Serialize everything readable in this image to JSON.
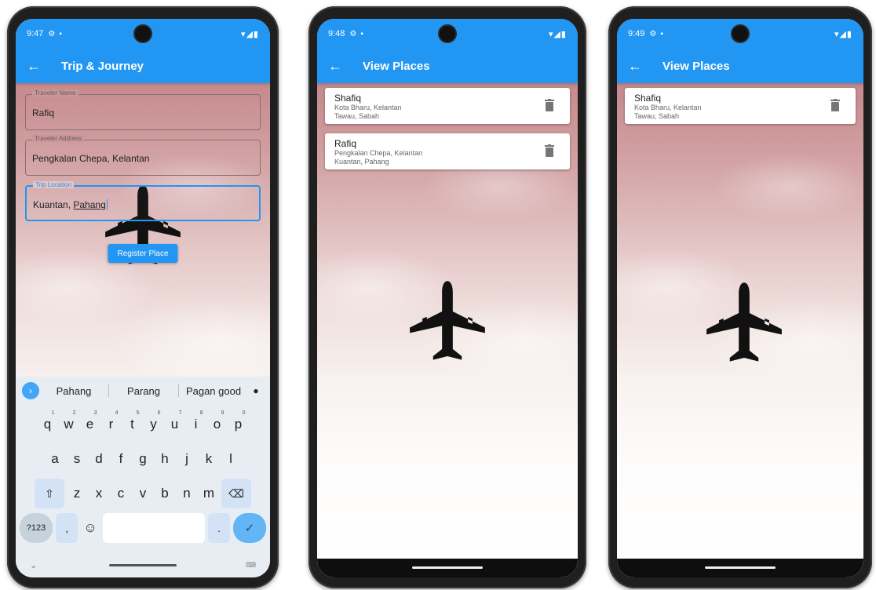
{
  "colors": {
    "accent": "#2196f3",
    "sky_top": "#b67a7e",
    "sky_bottom": "#ffffff"
  },
  "phone1": {
    "status": {
      "time": "9:47",
      "icons": [
        "settings-icon",
        "battery-small-icon"
      ],
      "right": "▾◢▮"
    },
    "appbar": {
      "back": "←",
      "title": "Trip & Journey"
    },
    "form": {
      "name_label": "Traveler Name",
      "name_value": "Rafiq",
      "address_label": "Traveler Address",
      "address_value": "Pengkalan Chepa, Kelantan",
      "location_label": "Trip Location",
      "location_value_a": "Kuantan, ",
      "location_value_b": "Pahang",
      "register_label": "Register Place"
    },
    "keyboard": {
      "go": "›",
      "suggestions": [
        "Pahang",
        "Parang",
        "Pagan good"
      ],
      "row1": [
        {
          "k": "q",
          "n": "1"
        },
        {
          "k": "w",
          "n": "2"
        },
        {
          "k": "e",
          "n": "3"
        },
        {
          "k": "r",
          "n": "4"
        },
        {
          "k": "t",
          "n": "5"
        },
        {
          "k": "y",
          "n": "6"
        },
        {
          "k": "u",
          "n": "7"
        },
        {
          "k": "i",
          "n": "8"
        },
        {
          "k": "o",
          "n": "9"
        },
        {
          "k": "p",
          "n": "0"
        }
      ],
      "row2": [
        "a",
        "s",
        "d",
        "f",
        "g",
        "h",
        "j",
        "k",
        "l"
      ],
      "shift": "⇧",
      "row3": [
        "z",
        "x",
        "c",
        "v",
        "b",
        "n",
        "m"
      ],
      "backspace": "⌫",
      "num": "?123",
      "comma": ",",
      "emoji": "☺",
      "period": ".",
      "enter": "✓",
      "nav_chevron": "⌄",
      "nav_kb": "⌨"
    }
  },
  "phone2": {
    "status": {
      "time": "9:48",
      "right": "▾◢▮"
    },
    "appbar": {
      "back": "←",
      "title": "View Places"
    },
    "items": [
      {
        "name": "Shafiq",
        "line1": "Kota Bharu, Kelantan",
        "line2": "Tawau, Sabah"
      },
      {
        "name": "Rafiq",
        "line1": "Pengkalan Chepa, Kelantan",
        "line2": "Kuantan, Pahang"
      }
    ]
  },
  "phone3": {
    "status": {
      "time": "9:49",
      "right": "▾◢▮"
    },
    "appbar": {
      "back": "←",
      "title": "View Places"
    },
    "items": [
      {
        "name": "Shafiq",
        "line1": "Kota Bharu, Kelantan",
        "line2": "Tawau, Sabah"
      }
    ]
  }
}
